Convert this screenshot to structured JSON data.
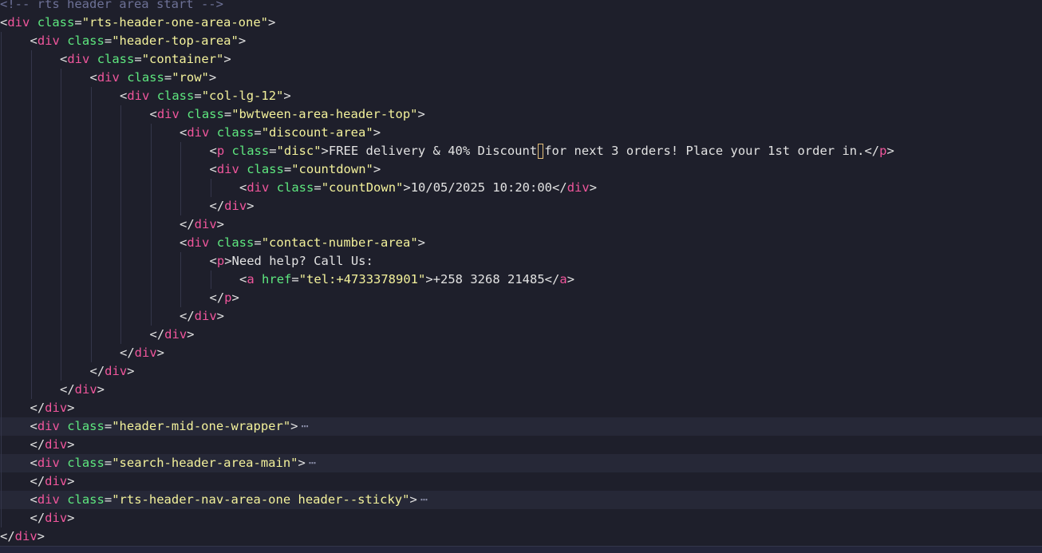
{
  "editor": {
    "lines": [
      {
        "indent": 0,
        "tokens": [
          {
            "t": "comment",
            "v": "<!-- rts header area start -->"
          }
        ]
      },
      {
        "indent": 0,
        "tokens": [
          {
            "t": "bracket",
            "v": "<"
          },
          {
            "t": "tag",
            "v": "div"
          },
          {
            "t": "text",
            "v": " "
          },
          {
            "t": "attr",
            "v": "class"
          },
          {
            "t": "eq",
            "v": "="
          },
          {
            "t": "str",
            "v": "\"rts-header-one-area-one\""
          },
          {
            "t": "bracket",
            "v": ">"
          }
        ]
      },
      {
        "indent": 1,
        "tokens": [
          {
            "t": "bracket",
            "v": "<"
          },
          {
            "t": "tag",
            "v": "div"
          },
          {
            "t": "text",
            "v": " "
          },
          {
            "t": "attr",
            "v": "class"
          },
          {
            "t": "eq",
            "v": "="
          },
          {
            "t": "str",
            "v": "\"header-top-area\""
          },
          {
            "t": "bracket",
            "v": ">"
          }
        ]
      },
      {
        "indent": 2,
        "tokens": [
          {
            "t": "bracket",
            "v": "<"
          },
          {
            "t": "tag",
            "v": "div"
          },
          {
            "t": "text",
            "v": " "
          },
          {
            "t": "attr",
            "v": "class"
          },
          {
            "t": "eq",
            "v": "="
          },
          {
            "t": "str",
            "v": "\"container\""
          },
          {
            "t": "bracket",
            "v": ">"
          }
        ]
      },
      {
        "indent": 3,
        "tokens": [
          {
            "t": "bracket",
            "v": "<"
          },
          {
            "t": "tag",
            "v": "div"
          },
          {
            "t": "text",
            "v": " "
          },
          {
            "t": "attr",
            "v": "class"
          },
          {
            "t": "eq",
            "v": "="
          },
          {
            "t": "str",
            "v": "\"row\""
          },
          {
            "t": "bracket",
            "v": ">"
          }
        ]
      },
      {
        "indent": 4,
        "tokens": [
          {
            "t": "bracket",
            "v": "<"
          },
          {
            "t": "tag",
            "v": "div"
          },
          {
            "t": "text",
            "v": " "
          },
          {
            "t": "attr",
            "v": "class"
          },
          {
            "t": "eq",
            "v": "="
          },
          {
            "t": "str",
            "v": "\"col-lg-12\""
          },
          {
            "t": "bracket",
            "v": ">"
          }
        ]
      },
      {
        "indent": 5,
        "tokens": [
          {
            "t": "bracket",
            "v": "<"
          },
          {
            "t": "tag",
            "v": "div"
          },
          {
            "t": "text",
            "v": " "
          },
          {
            "t": "attr",
            "v": "class"
          },
          {
            "t": "eq",
            "v": "="
          },
          {
            "t": "str",
            "v": "\"bwtween-area-header-top\""
          },
          {
            "t": "bracket",
            "v": ">"
          }
        ]
      },
      {
        "indent": 6,
        "tokens": [
          {
            "t": "bracket",
            "v": "<"
          },
          {
            "t": "tag",
            "v": "div"
          },
          {
            "t": "text",
            "v": " "
          },
          {
            "t": "attr",
            "v": "class"
          },
          {
            "t": "eq",
            "v": "="
          },
          {
            "t": "str",
            "v": "\"discount-area\""
          },
          {
            "t": "bracket",
            "v": ">"
          }
        ]
      },
      {
        "indent": 7,
        "cursor_after": 5,
        "tokens": [
          {
            "t": "bracket",
            "v": "<"
          },
          {
            "t": "tag",
            "v": "p"
          },
          {
            "t": "text",
            "v": " "
          },
          {
            "t": "attr",
            "v": "class"
          },
          {
            "t": "eq",
            "v": "="
          },
          {
            "t": "str",
            "v": "\"disc\""
          },
          {
            "t": "bracket",
            "v": ">"
          },
          {
            "t": "text",
            "v": "FREE delivery & 40% Discount"
          },
          {
            "t": "text",
            "v": "for next 3 orders! Place your 1st order in."
          },
          {
            "t": "bracket",
            "v": "</"
          },
          {
            "t": "tag",
            "v": "p"
          },
          {
            "t": "bracket",
            "v": ">"
          }
        ]
      },
      {
        "indent": 7,
        "tokens": [
          {
            "t": "bracket",
            "v": "<"
          },
          {
            "t": "tag",
            "v": "div"
          },
          {
            "t": "text",
            "v": " "
          },
          {
            "t": "attr",
            "v": "class"
          },
          {
            "t": "eq",
            "v": "="
          },
          {
            "t": "str",
            "v": "\"countdown\""
          },
          {
            "t": "bracket",
            "v": ">"
          }
        ]
      },
      {
        "indent": 8,
        "tokens": [
          {
            "t": "bracket",
            "v": "<"
          },
          {
            "t": "tag",
            "v": "div"
          },
          {
            "t": "text",
            "v": " "
          },
          {
            "t": "attr",
            "v": "class"
          },
          {
            "t": "eq",
            "v": "="
          },
          {
            "t": "str",
            "v": "\"countDown\""
          },
          {
            "t": "bracket",
            "v": ">"
          },
          {
            "t": "text",
            "v": "10/05/2025 10:20:00"
          },
          {
            "t": "bracket",
            "v": "</"
          },
          {
            "t": "tag",
            "v": "div"
          },
          {
            "t": "bracket",
            "v": ">"
          }
        ]
      },
      {
        "indent": 7,
        "tokens": [
          {
            "t": "bracket",
            "v": "</"
          },
          {
            "t": "tag",
            "v": "div"
          },
          {
            "t": "bracket",
            "v": ">"
          }
        ]
      },
      {
        "indent": 6,
        "tokens": [
          {
            "t": "bracket",
            "v": "</"
          },
          {
            "t": "tag",
            "v": "div"
          },
          {
            "t": "bracket",
            "v": ">"
          }
        ]
      },
      {
        "indent": 6,
        "tokens": [
          {
            "t": "bracket",
            "v": "<"
          },
          {
            "t": "tag",
            "v": "div"
          },
          {
            "t": "text",
            "v": " "
          },
          {
            "t": "attr",
            "v": "class"
          },
          {
            "t": "eq",
            "v": "="
          },
          {
            "t": "str",
            "v": "\"contact-number-area\""
          },
          {
            "t": "bracket",
            "v": ">"
          }
        ]
      },
      {
        "indent": 7,
        "tokens": [
          {
            "t": "bracket",
            "v": "<"
          },
          {
            "t": "tag",
            "v": "p"
          },
          {
            "t": "bracket",
            "v": ">"
          },
          {
            "t": "text",
            "v": "Need help? Call Us:"
          }
        ]
      },
      {
        "indent": 8,
        "tokens": [
          {
            "t": "bracket",
            "v": "<"
          },
          {
            "t": "tag",
            "v": "a"
          },
          {
            "t": "text",
            "v": " "
          },
          {
            "t": "attr",
            "v": "href"
          },
          {
            "t": "eq",
            "v": "="
          },
          {
            "t": "str",
            "v": "\"tel:+4733378901\""
          },
          {
            "t": "bracket",
            "v": ">"
          },
          {
            "t": "text",
            "v": "+258 3268 21485"
          },
          {
            "t": "bracket",
            "v": "</"
          },
          {
            "t": "tag",
            "v": "a"
          },
          {
            "t": "bracket",
            "v": ">"
          }
        ]
      },
      {
        "indent": 7,
        "tokens": [
          {
            "t": "bracket",
            "v": "</"
          },
          {
            "t": "tag",
            "v": "p"
          },
          {
            "t": "bracket",
            "v": ">"
          }
        ]
      },
      {
        "indent": 6,
        "tokens": [
          {
            "t": "bracket",
            "v": "</"
          },
          {
            "t": "tag",
            "v": "div"
          },
          {
            "t": "bracket",
            "v": ">"
          }
        ]
      },
      {
        "indent": 5,
        "tokens": [
          {
            "t": "bracket",
            "v": "</"
          },
          {
            "t": "tag",
            "v": "div"
          },
          {
            "t": "bracket",
            "v": ">"
          }
        ]
      },
      {
        "indent": 4,
        "tokens": [
          {
            "t": "bracket",
            "v": "</"
          },
          {
            "t": "tag",
            "v": "div"
          },
          {
            "t": "bracket",
            "v": ">"
          }
        ]
      },
      {
        "indent": 3,
        "tokens": [
          {
            "t": "bracket",
            "v": "</"
          },
          {
            "t": "tag",
            "v": "div"
          },
          {
            "t": "bracket",
            "v": ">"
          }
        ]
      },
      {
        "indent": 2,
        "tokens": [
          {
            "t": "bracket",
            "v": "</"
          },
          {
            "t": "tag",
            "v": "div"
          },
          {
            "t": "bracket",
            "v": ">"
          }
        ]
      },
      {
        "indent": 1,
        "tokens": [
          {
            "t": "bracket",
            "v": "</"
          },
          {
            "t": "tag",
            "v": "div"
          },
          {
            "t": "bracket",
            "v": ">"
          }
        ]
      },
      {
        "indent": 1,
        "folded": true,
        "tokens": [
          {
            "t": "bracket",
            "v": "<"
          },
          {
            "t": "tag",
            "v": "div"
          },
          {
            "t": "text",
            "v": " "
          },
          {
            "t": "attr",
            "v": "class"
          },
          {
            "t": "eq",
            "v": "="
          },
          {
            "t": "str",
            "v": "\"header-mid-one-wrapper\""
          },
          {
            "t": "bracket",
            "v": ">"
          }
        ]
      },
      {
        "indent": 1,
        "tokens": [
          {
            "t": "bracket",
            "v": "</"
          },
          {
            "t": "tag",
            "v": "div"
          },
          {
            "t": "bracket",
            "v": ">"
          }
        ]
      },
      {
        "indent": 1,
        "folded": true,
        "tokens": [
          {
            "t": "bracket",
            "v": "<"
          },
          {
            "t": "tag",
            "v": "div"
          },
          {
            "t": "text",
            "v": " "
          },
          {
            "t": "attr",
            "v": "class"
          },
          {
            "t": "eq",
            "v": "="
          },
          {
            "t": "str",
            "v": "\"search-header-area-main\""
          },
          {
            "t": "bracket",
            "v": ">"
          }
        ]
      },
      {
        "indent": 1,
        "tokens": [
          {
            "t": "bracket",
            "v": "</"
          },
          {
            "t": "tag",
            "v": "div"
          },
          {
            "t": "bracket",
            "v": ">"
          }
        ]
      },
      {
        "indent": 1,
        "folded": true,
        "tokens": [
          {
            "t": "bracket",
            "v": "<"
          },
          {
            "t": "tag",
            "v": "div"
          },
          {
            "t": "text",
            "v": " "
          },
          {
            "t": "attr",
            "v": "class"
          },
          {
            "t": "eq",
            "v": "="
          },
          {
            "t": "str",
            "v": "\"rts-header-nav-area-one header--sticky\""
          },
          {
            "t": "bracket",
            "v": ">"
          }
        ]
      },
      {
        "indent": 1,
        "tokens": [
          {
            "t": "bracket",
            "v": "</"
          },
          {
            "t": "tag",
            "v": "div"
          },
          {
            "t": "bracket",
            "v": ">"
          }
        ]
      },
      {
        "indent": 0,
        "tokens": [
          {
            "t": "bracket",
            "v": "</"
          },
          {
            "t": "tag",
            "v": "div"
          },
          {
            "t": "bracket",
            "v": ">"
          }
        ]
      }
    ],
    "fold_marker": "⋯"
  }
}
